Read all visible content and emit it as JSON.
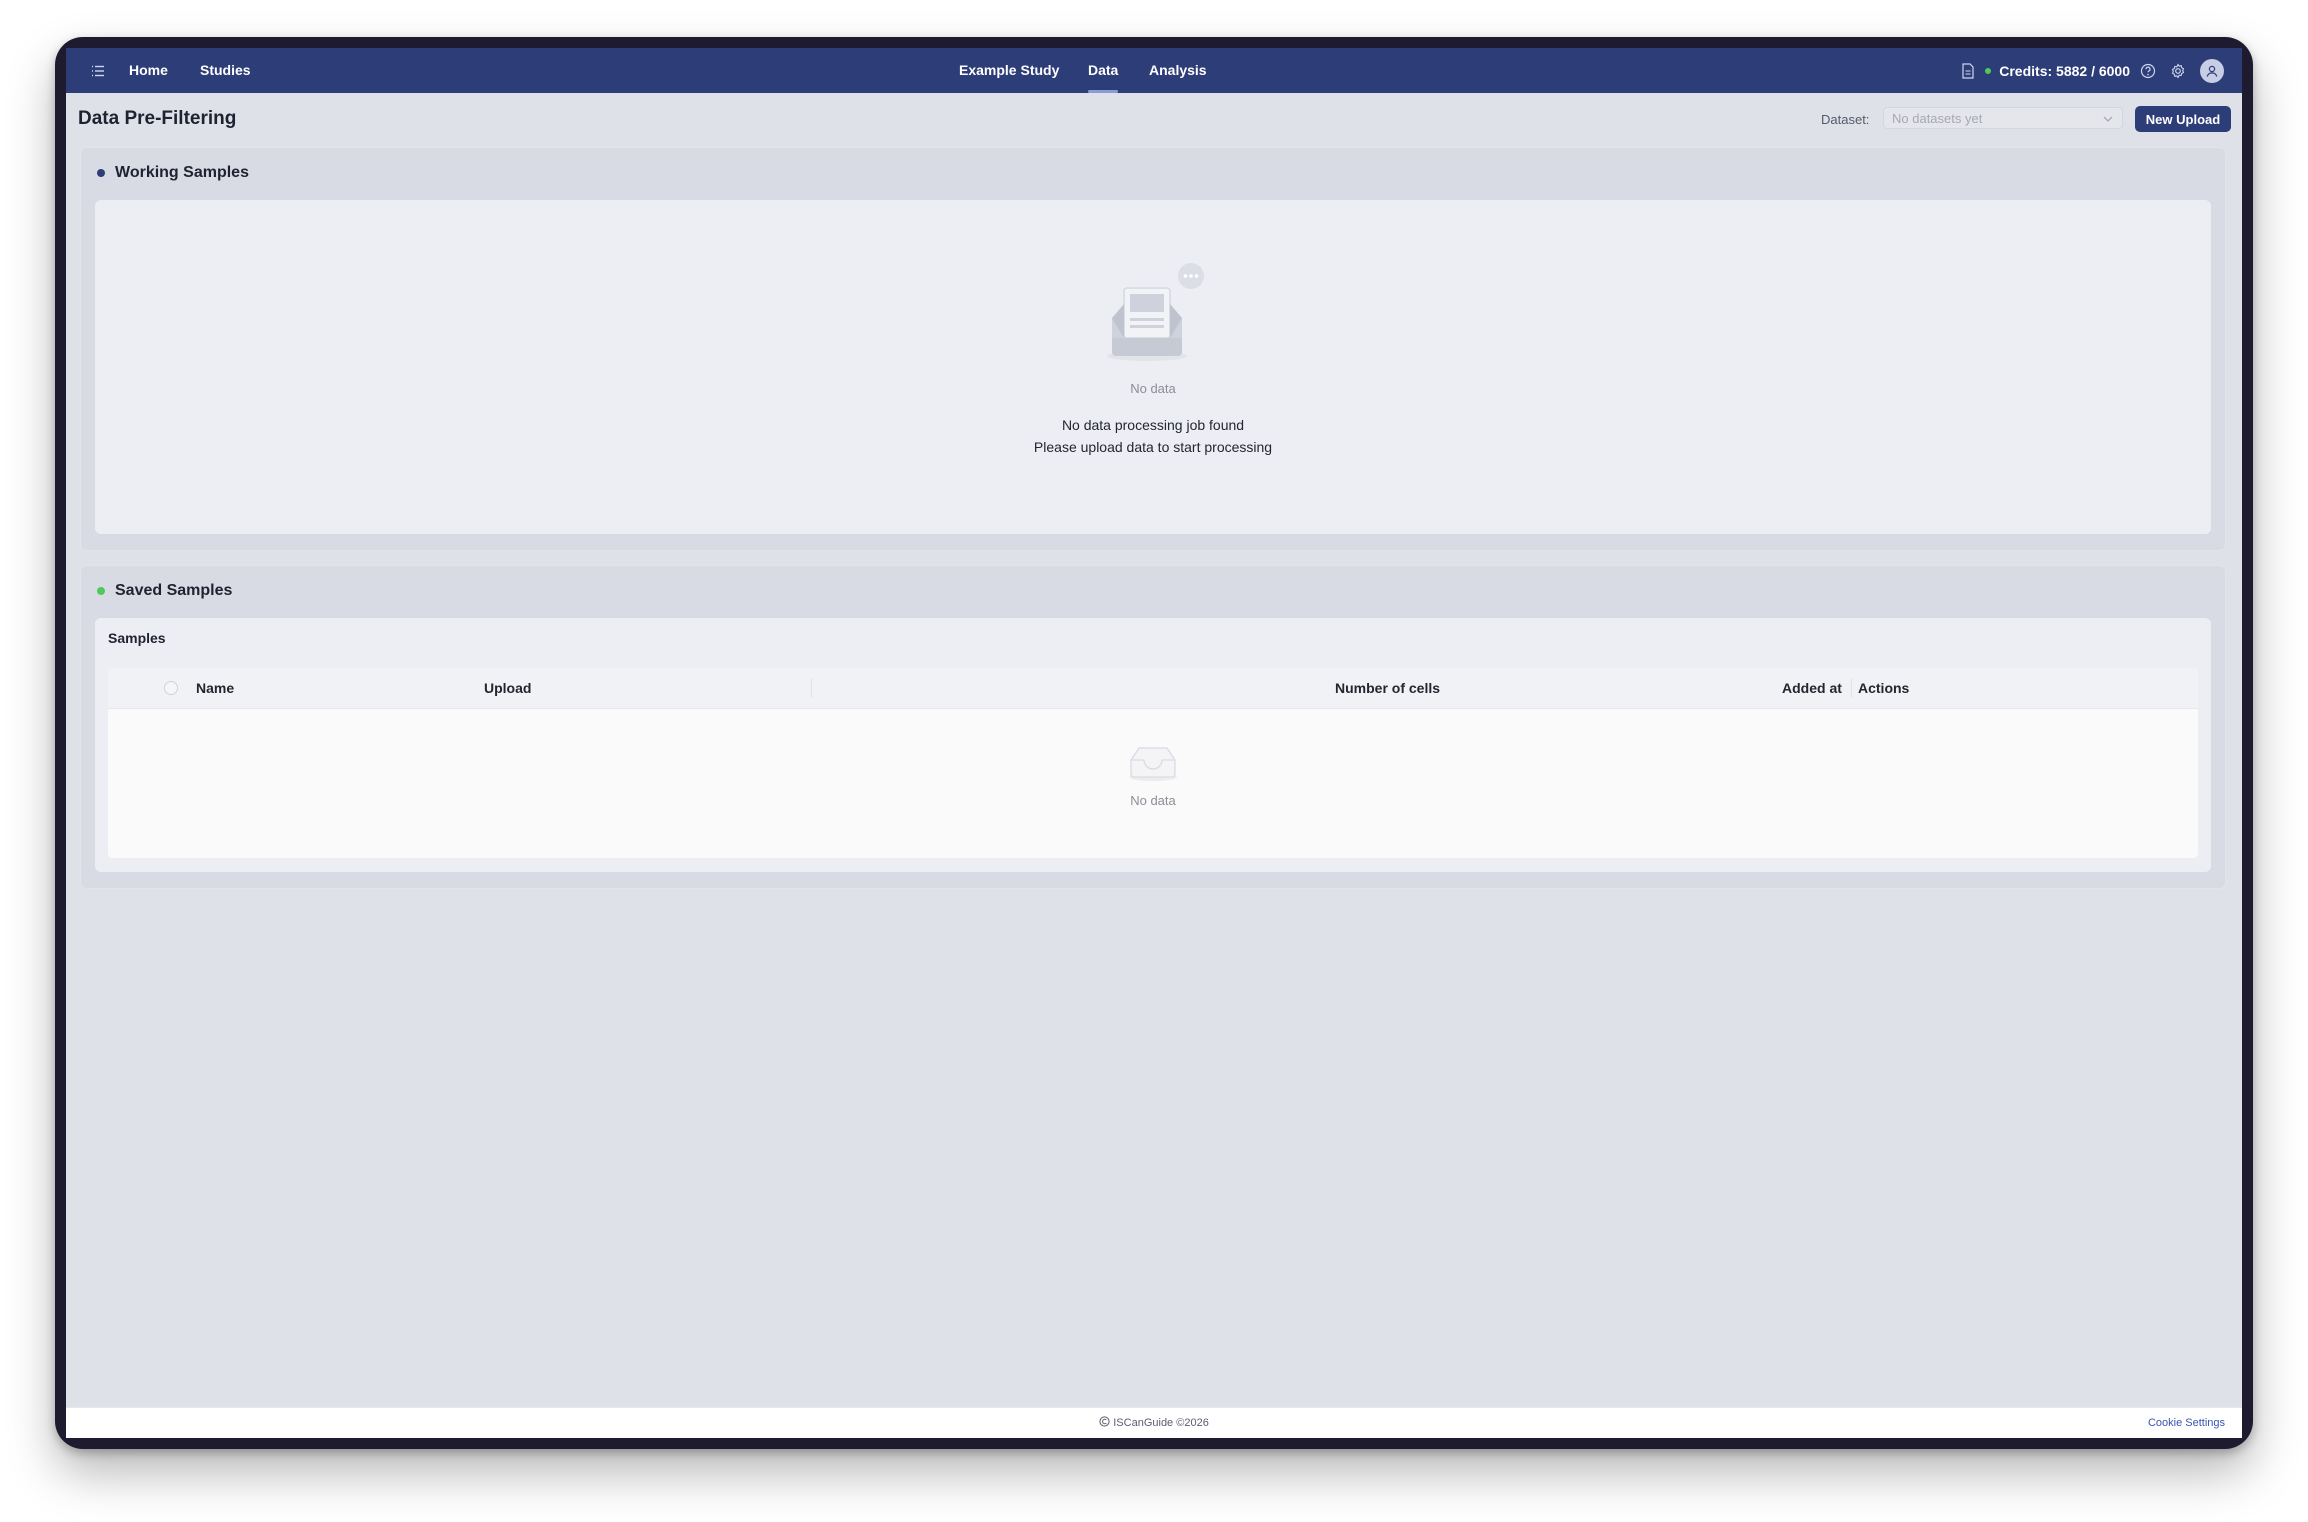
{
  "nav": {
    "left_links": [
      "Home",
      "Studies"
    ],
    "tabs": [
      "Example Study",
      "Data",
      "Analysis"
    ],
    "active_tab": "Data",
    "credits": "Credits: 5882 / 6000",
    "icons": [
      "menu-icon",
      "document-icon",
      "help-icon",
      "settings-icon",
      "user-icon"
    ],
    "status_color": "#4fc95a",
    "bg_color": "#2d3d78"
  },
  "page": {
    "title": "Data Pre-Filtering",
    "dataset_label": "Dataset:",
    "dataset_placeholder": "No datasets yet",
    "new_upload_label": "New Upload"
  },
  "working": {
    "title": "Working Samples",
    "bullet_color": "#2d3d78",
    "empty_label": "No data",
    "message_line1": "No data processing job found",
    "message_line2": "Please upload data to start processing"
  },
  "saved": {
    "title": "Saved Samples",
    "bullet_color": "#4fc95a",
    "card_title": "Samples",
    "columns": [
      "Name",
      "Upload",
      "Number of cells",
      "Added at",
      "Actions"
    ],
    "empty_label": "No data"
  },
  "footer": {
    "brand": "ISCanGuide ©2026",
    "cookie": "Cookie Settings"
  }
}
